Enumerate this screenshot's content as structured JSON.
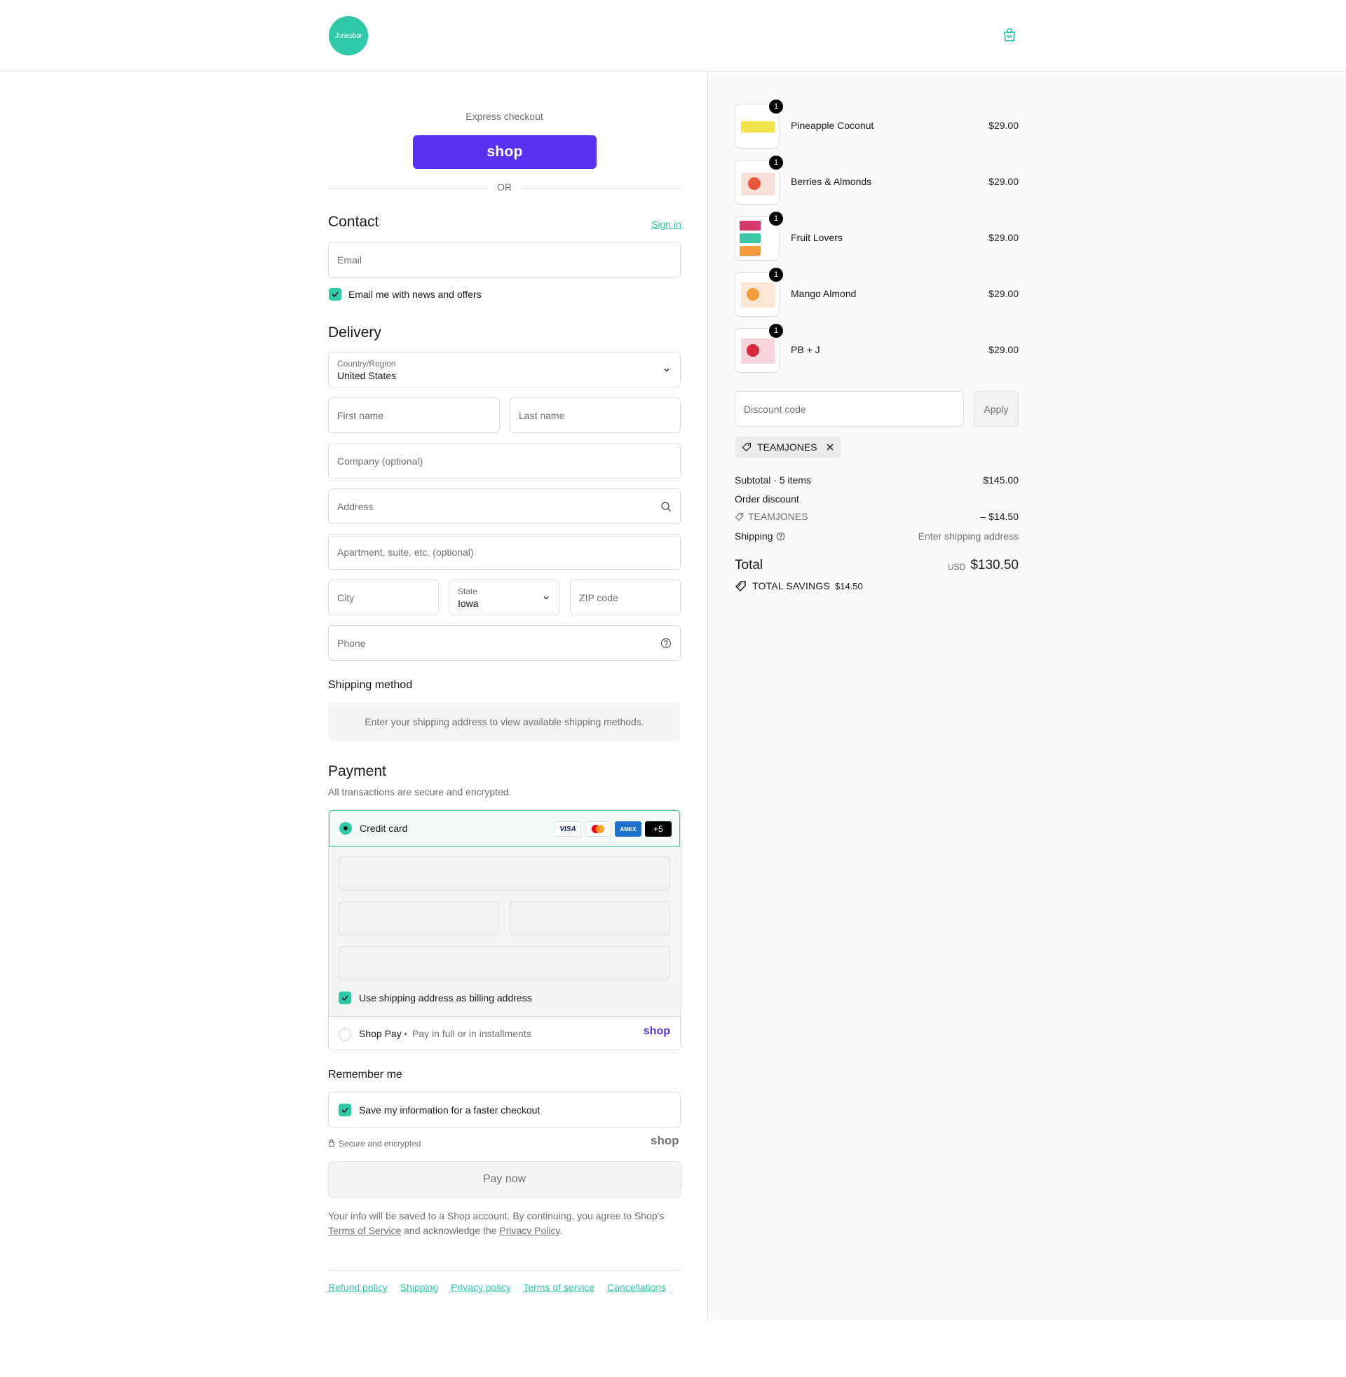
{
  "header": {
    "logo_text": "Jonesbar",
    "cart_icon": "shopping-bag-icon"
  },
  "express": {
    "title": "Express checkout",
    "shop_button": "shop",
    "or": "OR"
  },
  "contact": {
    "heading": "Contact",
    "sign_in": "Sign in",
    "email_placeholder": "Email",
    "newsletter_label": "Email me with news and offers",
    "newsletter_checked": true
  },
  "delivery": {
    "heading": "Delivery",
    "country_label": "Country/Region",
    "country_value": "United States",
    "first_name": "First name",
    "last_name": "Last name",
    "company": "Company (optional)",
    "address": "Address",
    "apartment": "Apartment, suite, etc. (optional)",
    "city": "City",
    "state_label": "State",
    "state_value": "Iowa",
    "zip": "ZIP code",
    "phone": "Phone"
  },
  "shipping_method": {
    "heading": "Shipping method",
    "message": "Enter your shipping address to view available shipping methods."
  },
  "payment": {
    "heading": "Payment",
    "subtitle": "All transactions are secure and encrypted.",
    "credit_card_label": "Credit card",
    "brands": [
      "VISA",
      "mastercard",
      "AMEX",
      "+5"
    ],
    "billing_label": "Use shipping address as billing address",
    "shop_pay_label": "Shop Pay",
    "shop_pay_sub": "Pay in full or in installments",
    "shop_pay_logo": "shop"
  },
  "remember": {
    "heading": "Remember me",
    "save_label": "Save my information for a faster checkout",
    "secure_label": "Secure and encrypted",
    "shop_logo": "shop"
  },
  "pay_now": "Pay now",
  "legal": {
    "text1": "Your info will be saved to a Shop account. By continuing, you agree to Shop's",
    "tos": "Terms of Service",
    "text2": "and acknowledge the",
    "privacy": "Privacy Policy",
    "text3": "."
  },
  "footer_links": [
    "Refund policy",
    "Shipping",
    "Privacy policy",
    "Terms of service",
    "Cancellations"
  ],
  "cart": {
    "items": [
      {
        "name": "Pineapple Coconut",
        "price": "$29.00",
        "qty": "1",
        "color": "#f2e34c"
      },
      {
        "name": "Berries & Almonds",
        "price": "$29.00",
        "qty": "1",
        "color": "#e9563c"
      },
      {
        "name": "Fruit Lovers",
        "price": "$29.00",
        "qty": "1",
        "color": "#d63b6b"
      },
      {
        "name": "Mango Almond",
        "price": "$29.00",
        "qty": "1",
        "color": "#f39a3a"
      },
      {
        "name": "PB + J",
        "price": "$29.00",
        "qty": "1",
        "color": "#d6283f"
      }
    ],
    "discount_placeholder": "Discount code",
    "apply": "Apply",
    "applied_code": "TEAMJONES",
    "subtotal_label": "Subtotal · 5 items",
    "subtotal_value": "$145.00",
    "order_discount_label": "Order discount",
    "order_discount_code": "TEAMJONES",
    "order_discount_value": "– $14.50",
    "shipping_label": "Shipping",
    "shipping_value": "Enter shipping address",
    "total_label": "Total",
    "total_currency": "USD",
    "total_value": "$130.50",
    "savings_label": "TOTAL SAVINGS",
    "savings_value": "$14.50"
  },
  "colors": {
    "accent": "#2ec9a7",
    "shop_purple": "#5a31f4"
  }
}
